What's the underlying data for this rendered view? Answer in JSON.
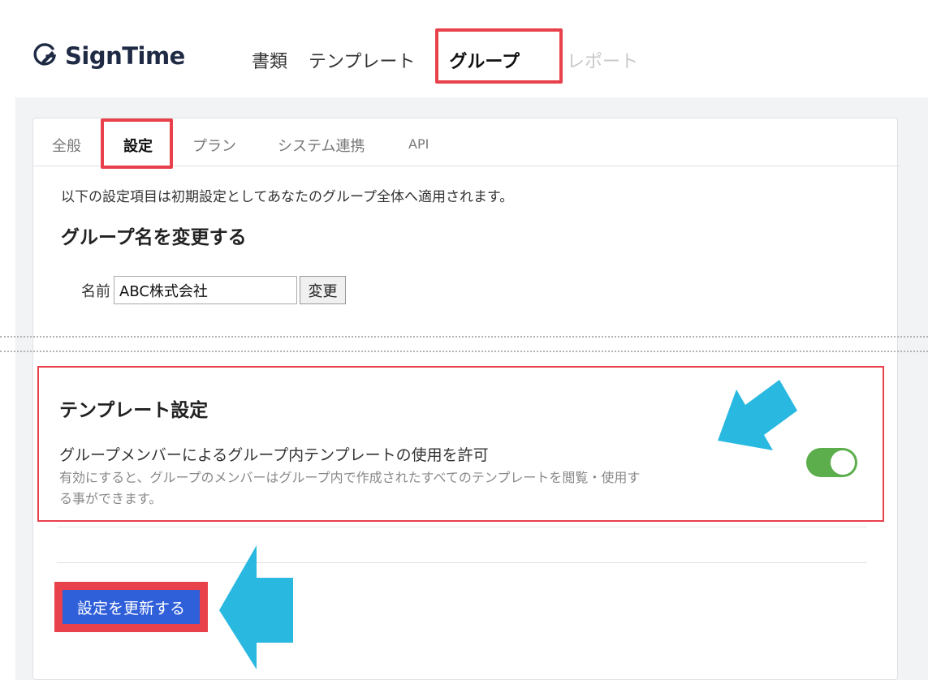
{
  "brand": {
    "name": "SignTime"
  },
  "topnav": {
    "documents": "書類",
    "templates": "テンプレート",
    "group": "グループ",
    "reports": "レポート"
  },
  "tabs": {
    "general": "全般",
    "settings": "設定",
    "plan": "プラン",
    "integration": "システム連携",
    "api": "API"
  },
  "settings": {
    "intro": "以下の設定項目は初期設定としてあなたのグループ全体へ適用されます。",
    "rename_heading": "グループ名を変更する",
    "name_label": "名前",
    "name_value": "ABC株式会社",
    "change_button": "変更"
  },
  "template_settings": {
    "heading": "テンプレート設定",
    "allow_label": "グループメンバーによるグループ内テンプレートの使用を許可",
    "allow_description": "有効にすると、グループのメンバーはグループ内で作成されたすべてのテンプレートを閲覧・使用する事ができます。",
    "toggle_enabled": true
  },
  "actions": {
    "update_button": "設定を更新する"
  },
  "colors": {
    "highlight_red": "#e8414b",
    "callout_arrow": "#29b8e0",
    "toggle_on": "#5cae4d",
    "primary_button": "#2f5fd9"
  }
}
